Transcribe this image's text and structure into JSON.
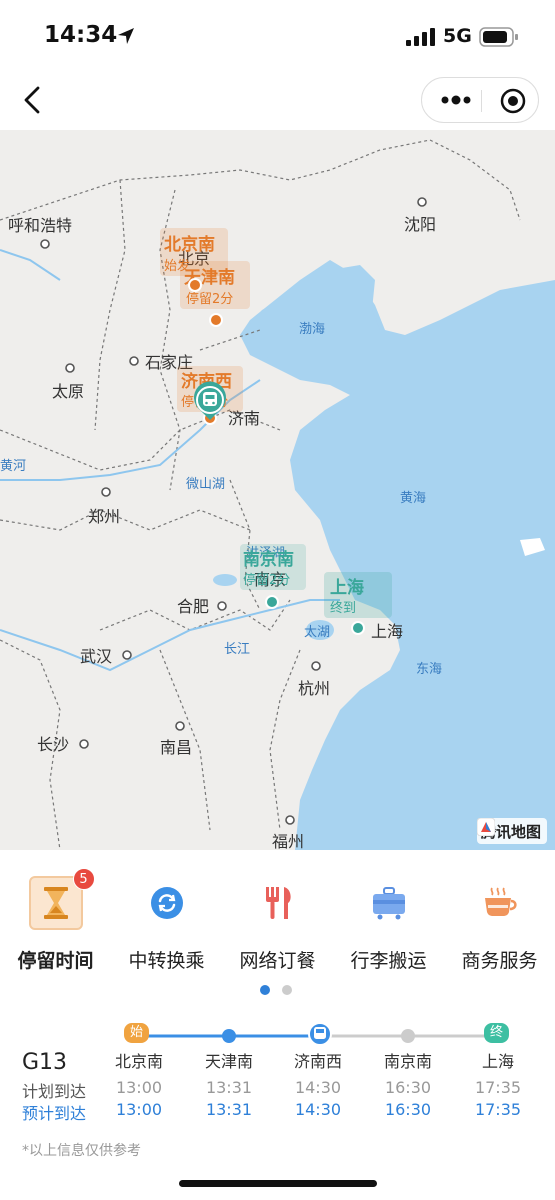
{
  "status": {
    "time": "14:34",
    "network": "5G"
  },
  "map": {
    "cities": [
      "呼和浩特",
      "北京",
      "沈阳",
      "石家庄",
      "太原",
      "济南",
      "郑州",
      "合肥",
      "南京",
      "武汉",
      "上海",
      "杭州",
      "长沙",
      "南昌",
      "福州"
    ],
    "water": [
      "渤海",
      "黄海",
      "东海",
      "微山湖",
      "洪泽湖",
      "太湖",
      "长江",
      "黄河"
    ],
    "stops": [
      {
        "name": "北京南",
        "note": "始发"
      },
      {
        "name": "天津南",
        "note": "停留2分"
      },
      {
        "name": "济南西",
        "note": "停留2分"
      },
      {
        "name": "南京南",
        "note": "停留2分"
      },
      {
        "name": "上海",
        "note": "终到"
      }
    ],
    "logo": "腾讯地图"
  },
  "services": [
    {
      "label": "停留时间",
      "icon": "hourglass-icon",
      "badge": "5"
    },
    {
      "label": "中转换乘",
      "icon": "transfer-icon"
    },
    {
      "label": "网络订餐",
      "icon": "fork-knife-icon"
    },
    {
      "label": "行李搬运",
      "icon": "luggage-icon"
    },
    {
      "label": "商务服务",
      "icon": "coffee-cup-icon"
    }
  ],
  "trip": {
    "train_no": "G13",
    "plan_label": "计划到达",
    "est_label": "预计到达",
    "start_tag": "始",
    "end_tag": "终",
    "stations": [
      {
        "name": "北京南",
        "plan": "13:00",
        "est": "13:00"
      },
      {
        "name": "天津南",
        "plan": "13:31",
        "est": "13:31"
      },
      {
        "name": "济南西",
        "plan": "14:30",
        "est": "14:30"
      },
      {
        "name": "南京南",
        "plan": "16:30",
        "est": "16:30"
      },
      {
        "name": "上海",
        "plan": "17:35",
        "est": "17:35"
      }
    ]
  },
  "note": "*以上信息仅供参考",
  "colors": {
    "accent": "#2f80d8",
    "stop_orange": "#e37a2a",
    "stop_teal": "#3aa79a",
    "sea": "#a8d3f0"
  }
}
